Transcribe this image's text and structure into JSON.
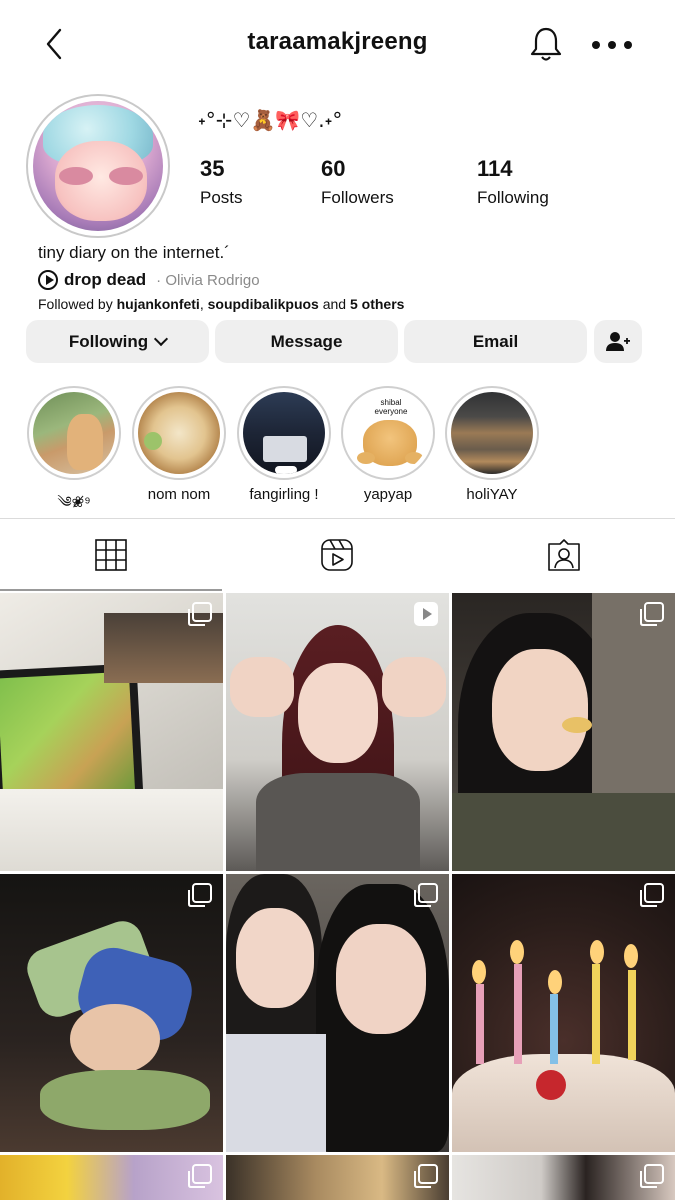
{
  "header": {
    "username": "taraamakjreeng"
  },
  "profile": {
    "bio_emoji": "˖°⊹♡🧸🎀♡.˖°",
    "stats": [
      {
        "value": "35",
        "label": "Posts"
      },
      {
        "value": "60",
        "label": "Followers"
      },
      {
        "value": "114",
        "label": "Following"
      }
    ],
    "bio": "tiny diary on the internet.´",
    "music": {
      "song": "drop dead",
      "artist": "· Olivia Rodrigo"
    },
    "followed_by": {
      "prefix": "Followed by ",
      "user1": "hujankonfeti",
      "sep": ", ",
      "user2": "soupdibalikpuos",
      "mid": " and ",
      "others": "5 others"
    }
  },
  "actions": {
    "following": "Following",
    "message": "Message",
    "email": "Email"
  },
  "highlights": [
    {
      "label": "༄❀̸⁹"
    },
    {
      "label": "nom nom"
    },
    {
      "label": "fangirling !"
    },
    {
      "label": "yapyap",
      "sticker_text": "shibal everyone"
    },
    {
      "label": "holiYAY"
    }
  ],
  "colors": {
    "button_bg": "#efefef",
    "divider": "#dbdbdb",
    "secondary_text": "#8a8a8a"
  }
}
